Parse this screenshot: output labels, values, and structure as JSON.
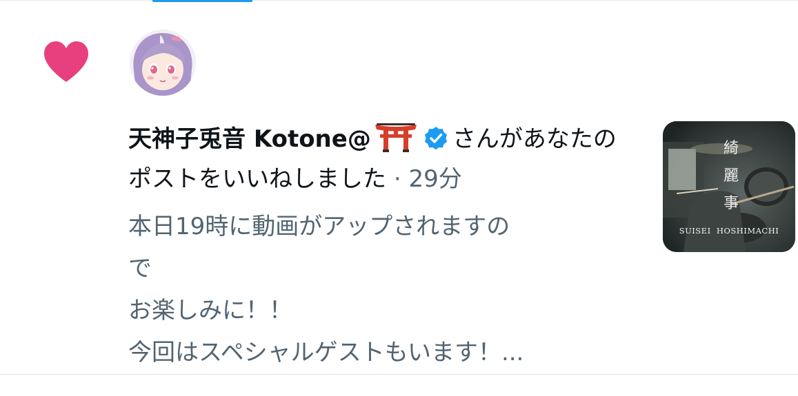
{
  "notification": {
    "type_icon": "heart-icon",
    "icon_color": "#e8407e",
    "avatar": "user-avatar",
    "user_name": "天神子兎音 Kotone@",
    "name_emoji": "torii-gate-icon",
    "verified_icon": "verified-badge-icon",
    "verified_color": "#1d9bf0",
    "action_text": "さんがあなたのポストをいいねしました",
    "separator": "·",
    "time_ago": "29分",
    "preview_lines": [
      "本日19時に動画がアップされますの",
      "で",
      "お楽しみに！！",
      "今回はスペシャルゲストもいます！..."
    ],
    "thumbnail": {
      "title_chars": [
        "綺",
        "麗",
        "事"
      ],
      "caption": "SUISEI  HOSHIMACHI"
    }
  }
}
